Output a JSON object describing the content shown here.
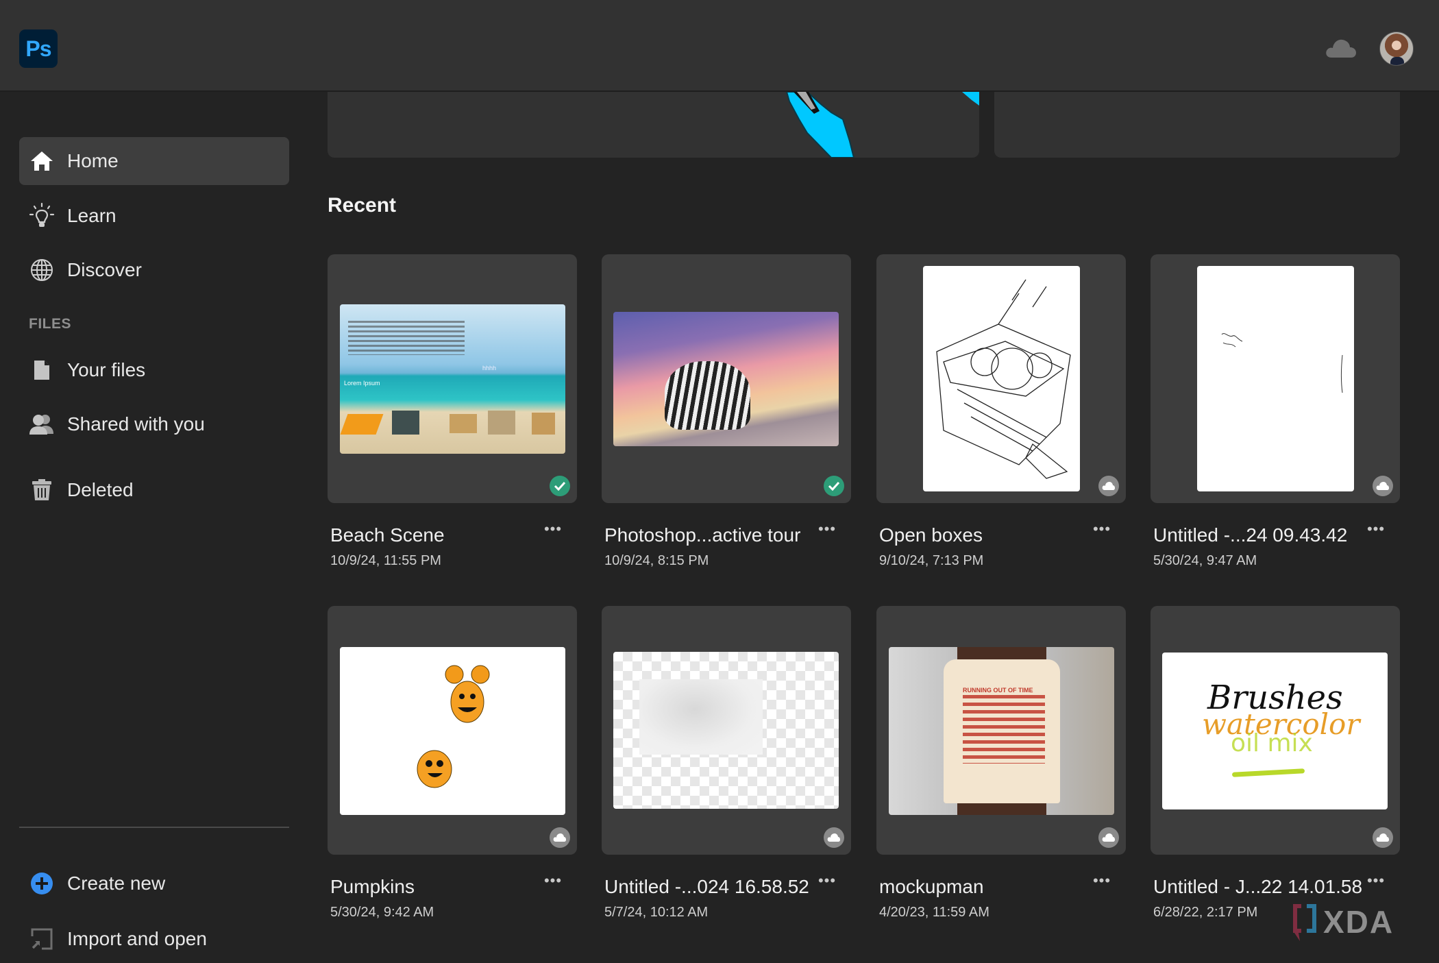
{
  "app": {
    "logo_text": "Ps",
    "name": "Photoshop"
  },
  "header": {
    "cloud_icon": "cloud-icon",
    "avatar_alt": "User avatar"
  },
  "sidebar": {
    "items": [
      {
        "label": "Home",
        "icon": "home-icon",
        "active": true
      },
      {
        "label": "Learn",
        "icon": "lightbulb-icon",
        "active": false
      },
      {
        "label": "Discover",
        "icon": "globe-icon",
        "active": false
      }
    ],
    "files_section_label": "FILES",
    "file_items": [
      {
        "label": "Your files",
        "icon": "file-icon"
      },
      {
        "label": "Shared with you",
        "icon": "people-icon"
      },
      {
        "label": "Deleted",
        "icon": "trash-icon"
      }
    ],
    "actions": [
      {
        "label": "Create new",
        "icon": "plus-circle-icon"
      },
      {
        "label": "Import and open",
        "icon": "import-icon"
      }
    ]
  },
  "main": {
    "recent_heading": "Recent",
    "files": [
      {
        "title": "Beach Scene",
        "date": "10/9/24, 11:55 PM",
        "status": "synced",
        "thumb": "beach"
      },
      {
        "title": "Photoshop...active tour",
        "date": "10/9/24, 8:15 PM",
        "status": "synced",
        "thumb": "zebra-elephant"
      },
      {
        "title": "Open boxes",
        "date": "9/10/24, 7:13 PM",
        "status": "cloud",
        "thumb": "sketch-box"
      },
      {
        "title": "Untitled -...24 09.43.42",
        "date": "5/30/24, 9:47 AM",
        "status": "cloud",
        "thumb": "blank-sketch"
      },
      {
        "title": "Pumpkins",
        "date": "5/30/24, 9:42 AM",
        "status": "cloud",
        "thumb": "pumpkins"
      },
      {
        "title": "Untitled -...024 16.58.52",
        "date": "5/7/24, 10:12 AM",
        "status": "cloud",
        "thumb": "transparent"
      },
      {
        "title": "mockupman",
        "date": "4/20/23, 11:59 AM",
        "status": "cloud",
        "thumb": "tshirt-mockup"
      },
      {
        "title": "Untitled - J...22 14.01.58",
        "date": "6/28/22, 2:17 PM",
        "status": "cloud",
        "thumb": "brushes"
      }
    ],
    "more_label": "•••",
    "thumb_texts": {
      "beach_overlay": "Lorem   Ipsum",
      "beach_small": "hhhh",
      "tshirt_line": "RUNNING OUT OF TIME",
      "brushes_word1": "Brushes",
      "brushes_word2": "watercolor",
      "brushes_word3": "oil mix"
    }
  },
  "watermark": {
    "text": "XDA"
  },
  "colors": {
    "accent_blue": "#31a8ff",
    "sync_green": "#2d9d78",
    "create_blue": "#378ef0"
  }
}
